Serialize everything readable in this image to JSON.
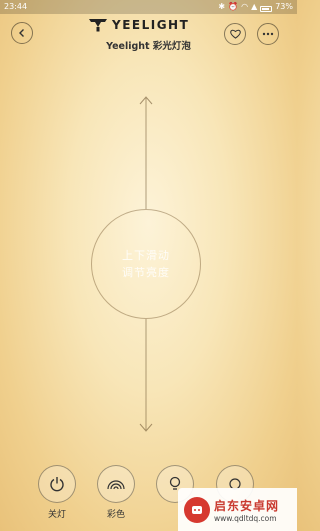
{
  "status_bar": {
    "time": "23:44",
    "battery": "73%"
  },
  "header": {
    "brand": "YEELIGHT",
    "subtitle": "Yeelight 彩光灯泡"
  },
  "center": {
    "hint_line1": "上下滑动",
    "hint_line2": "调节亮度"
  },
  "bottom_bar": {
    "items": [
      {
        "label": "关灯",
        "icon": "power-icon"
      },
      {
        "label": "彩色",
        "icon": "rainbow-icon"
      },
      {
        "label": "",
        "icon": "lamp-icon"
      },
      {
        "label": "",
        "icon": "scene-icon"
      }
    ]
  },
  "watermark": {
    "title": "启东安卓网",
    "url": "www.qdltdq.com"
  },
  "colors": {
    "background_center": "#fdf3d8",
    "background_edge": "#e9c27a",
    "watermark_red": "#c93a2f"
  }
}
